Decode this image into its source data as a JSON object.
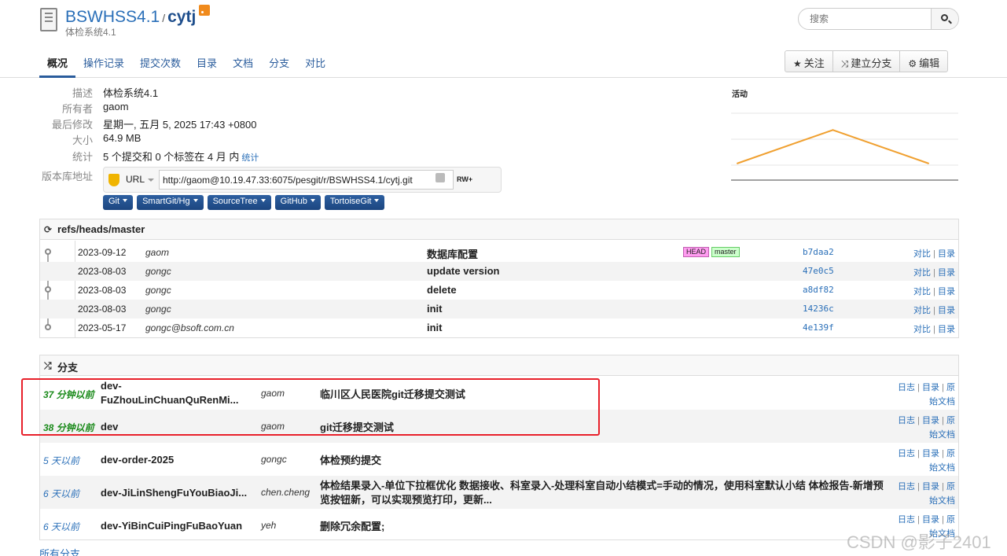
{
  "header": {
    "project": "BSWHSS4.1",
    "separator": "/",
    "repo": "cytj",
    "subtitle": "体检系统4.1",
    "search_placeholder": "搜索"
  },
  "nav": [
    {
      "label": "概况",
      "active": true
    },
    {
      "label": "操作记录"
    },
    {
      "label": "提交次数"
    },
    {
      "label": "目录"
    },
    {
      "label": "文档"
    },
    {
      "label": "分支"
    },
    {
      "label": "对比"
    }
  ],
  "actions": {
    "watch": "关注",
    "fork": "建立分支",
    "edit": "编辑"
  },
  "summary": {
    "description_label": "描述",
    "description": "体检系统4.1",
    "owner_label": "所有者",
    "owner": "gaom",
    "modified_label": "最后修改",
    "modified": "星期一, 五月 5, 2025 17:43 +0800",
    "size_label": "大小",
    "size": "64.9 MB",
    "stats_label": "统计",
    "stats": "5 个提交和 0 个标签在 4 月 内",
    "stats_link": "统计",
    "url_label_left": "版本库地址",
    "url_type": "URL",
    "url": "http://gaom@10.19.47.33:6075/pesgit/r/BSWHSS4.1/cytj.git",
    "access": "RW+",
    "clients": [
      "Git",
      "SmartGit/Hg",
      "SourceTree",
      "GitHub",
      "TortoiseGit"
    ]
  },
  "activity": {
    "title": "活动"
  },
  "chart_data": {
    "type": "line",
    "title": "活动",
    "values": [
      0,
      2,
      0
    ],
    "ylim": [
      -1,
      3
    ],
    "color": "#f0a030"
  },
  "log": {
    "title": "refs/heads/master",
    "commits": [
      {
        "date": "2023-09-12",
        "author": "gaom",
        "message": "数据库配置",
        "sha": "b7daa2",
        "head": "HEAD",
        "branch": "master"
      },
      {
        "date": "2023-08-03",
        "author": "gongc",
        "message": "update version",
        "sha": "47e0c5"
      },
      {
        "date": "2023-08-03",
        "author": "gongc",
        "message": "delete",
        "sha": "a8df82"
      },
      {
        "date": "2023-08-03",
        "author": "gongc",
        "message": "init",
        "sha": "14236c"
      },
      {
        "date": "2023-05-17",
        "author": "gongc@bsoft.com.cn",
        "message": "init",
        "sha": "4e139f"
      }
    ],
    "link_compare": "对比",
    "link_tree": "目录",
    "link_sep": " | "
  },
  "branches": {
    "title": "分支",
    "items": [
      {
        "when": "37 分钟以前",
        "name_l1": "dev-",
        "name_l2": "FuZhouLinChuanQuRenMi...",
        "author": "gaom",
        "message": "临川区人民医院git迁移提交测试"
      },
      {
        "when": "38 分钟以前",
        "name": "dev",
        "author": "gaom",
        "message": "git迁移提交测试"
      },
      {
        "when": "5 天以前",
        "name": "dev-order-2025",
        "author": "gongc",
        "message": "体检预约提交"
      },
      {
        "when": "6 天以前",
        "name": "dev-JiLinShengFuYouBiaoJi...",
        "author": "chen.cheng",
        "message_l1": "体检结果录入-单位下拉框优化 数据接收、科室录入-处理科室自动小结模式=手动的情况，使用科室默认小结 体检报告-新增预",
        "message_l2": "览按钮新，可以实现预览打印，更新..."
      },
      {
        "when": "6 天以前",
        "name": "dev-YiBinCuiPingFuBaoYuan",
        "author": "yeh",
        "message": "删除冗余配置;"
      }
    ],
    "link_log": "日志",
    "link_tree": "目录",
    "link_raw_a": "原",
    "link_raw_b": "始文档",
    "all": "所有分支..."
  },
  "watermark": "CSDN @影子2401"
}
